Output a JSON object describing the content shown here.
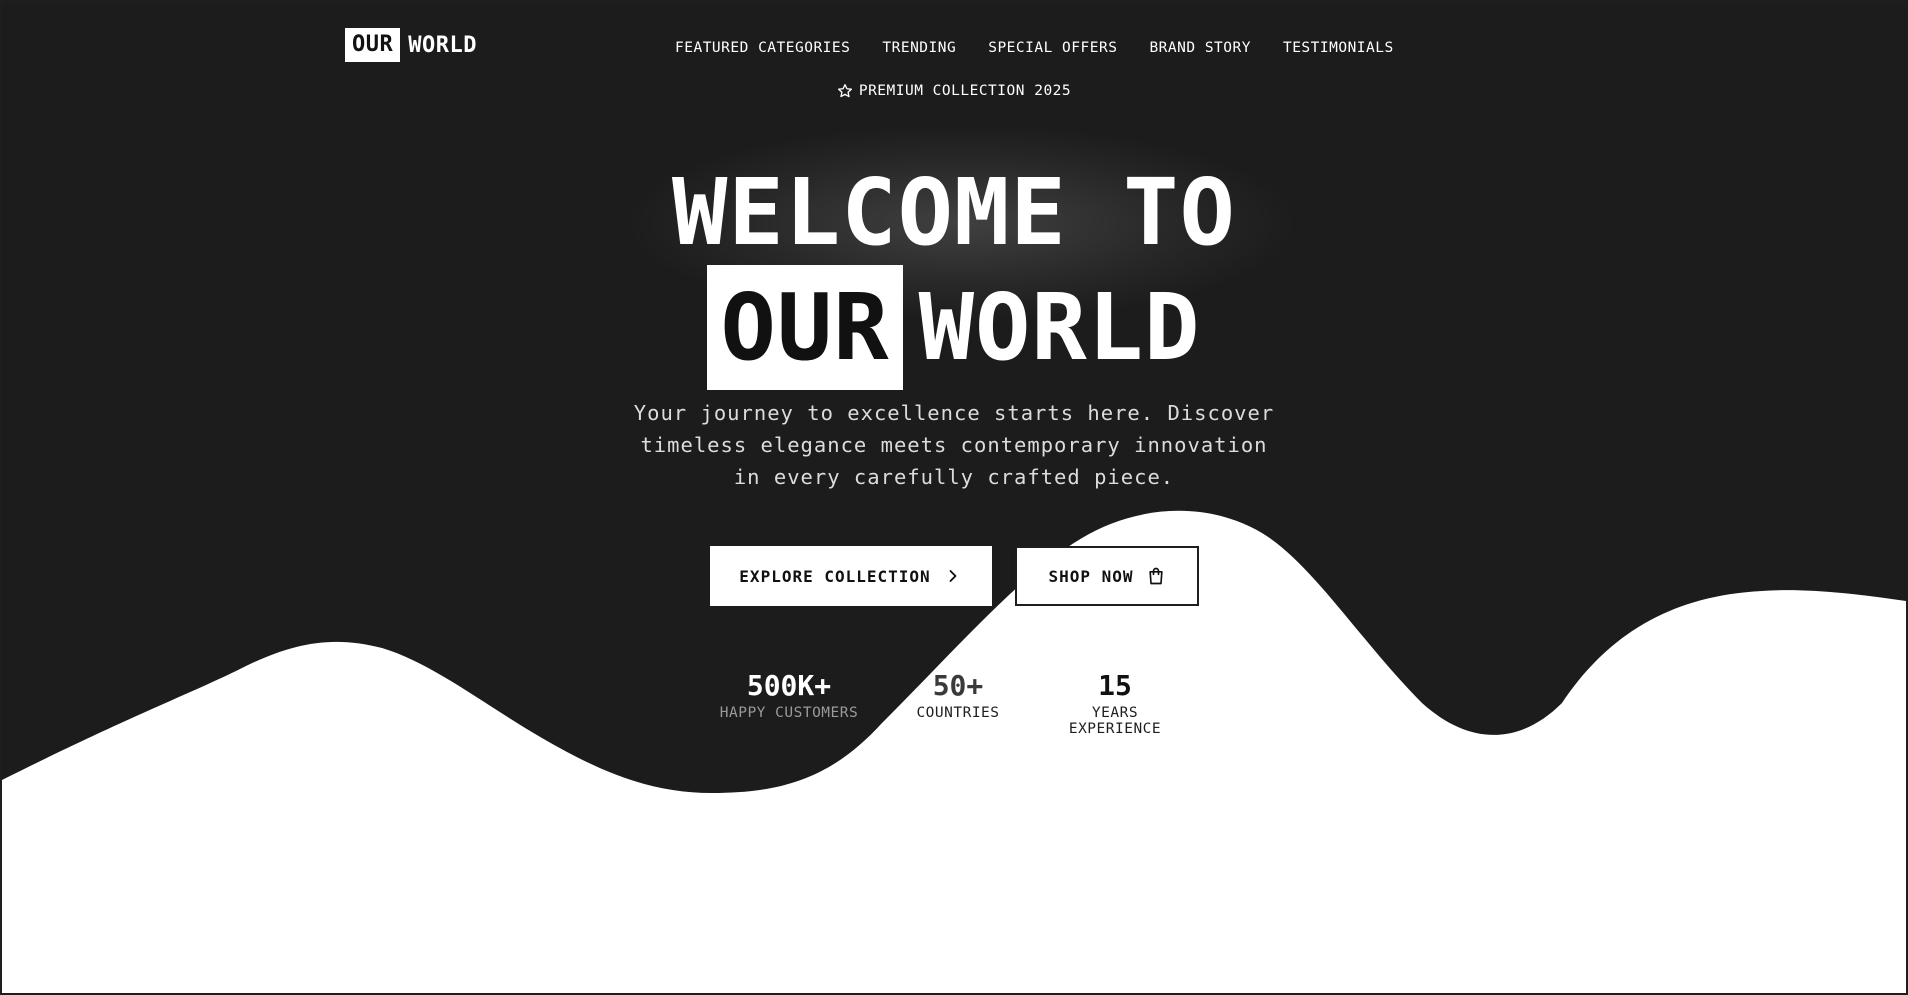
{
  "brand": {
    "logo_box": "OUR",
    "logo_word": "WORLD"
  },
  "nav": [
    {
      "label": "FEATURED CATEGORIES"
    },
    {
      "label": "TRENDING"
    },
    {
      "label": "SPECIAL OFFERS"
    },
    {
      "label": "BRAND STORY"
    },
    {
      "label": "TESTIMONIALS"
    }
  ],
  "hero": {
    "badge_icon": "star-icon",
    "badge": "PREMIUM COLLECTION 2025",
    "title_line1": "WELCOME TO",
    "title_highlight": "OUR",
    "title_rest": "WORLD",
    "subtitle": "Your journey to excellence starts here. Discover timeless elegance meets contemporary innovation in every carefully crafted piece.",
    "cta_primary": "EXPLORE COLLECTION",
    "cta_primary_icon": "chevron-right-icon",
    "cta_secondary": "SHOP NOW",
    "cta_secondary_icon": "shopping-bag-icon"
  },
  "stats": [
    {
      "value": "500K+",
      "label": "HAPPY CUSTOMERS"
    },
    {
      "value": "50+",
      "label": "COUNTRIES"
    },
    {
      "value": "15",
      "label": "YEARS EXPERIENCE"
    }
  ],
  "colors": {
    "dark": "#1c1c1c",
    "light": "#ffffff"
  }
}
